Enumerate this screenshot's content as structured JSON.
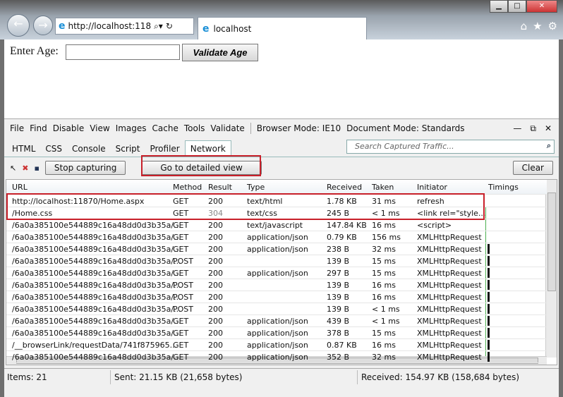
{
  "browser": {
    "address": "http://localhost:118",
    "tab_title": "localhost",
    "window_controls": [
      "minimize",
      "maximize",
      "close"
    ]
  },
  "page": {
    "label": "Enter Age:",
    "input_value": "",
    "button": "Validate Age"
  },
  "devtools": {
    "menu": [
      "File",
      "Find",
      "Disable",
      "View",
      "Images",
      "Cache",
      "Tools",
      "Validate"
    ],
    "browser_mode": "Browser Mode: IE10",
    "document_mode": "Document Mode: Standards",
    "tabs": [
      "HTML",
      "CSS",
      "Console",
      "Script",
      "Profiler",
      "Network"
    ],
    "active_tab": "Network",
    "search_placeholder": "Search Captured Traffic...",
    "stop_button": "Stop capturing",
    "detail_button": "Go to detailed view",
    "clear_button": "Clear",
    "columns": [
      "URL",
      "Method",
      "Result",
      "Type",
      "Received",
      "Taken",
      "Initiator",
      "Timings"
    ],
    "rows": [
      [
        "http://localhost:11870/Home.aspx",
        "GET",
        "200",
        "text/html",
        "1.78 KB",
        "31 ms",
        "refresh"
      ],
      [
        "/Home.css",
        "GET",
        "304",
        "text/css",
        "245 B",
        "< 1 ms",
        "<link rel=\"style..."
      ],
      [
        "/6a0a385100e544889c16a48dd0d3b35a/...",
        "GET",
        "200",
        "text/javascript",
        "147.84 KB",
        "16 ms",
        "<script>"
      ],
      [
        "/6a0a385100e544889c16a48dd0d3b35a/...",
        "GET",
        "200",
        "application/json",
        "0.79 KB",
        "156 ms",
        "XMLHttpRequest"
      ],
      [
        "/6a0a385100e544889c16a48dd0d3b35a/...",
        "GET",
        "200",
        "application/json",
        "238 B",
        "32 ms",
        "XMLHttpRequest"
      ],
      [
        "/6a0a385100e544889c16a48dd0d3b35a/...",
        "POST",
        "200",
        "",
        "139 B",
        "15 ms",
        "XMLHttpRequest"
      ],
      [
        "/6a0a385100e544889c16a48dd0d3b35a/...",
        "GET",
        "200",
        "application/json",
        "297 B",
        "15 ms",
        "XMLHttpRequest"
      ],
      [
        "/6a0a385100e544889c16a48dd0d3b35a/...",
        "POST",
        "200",
        "",
        "139 B",
        "16 ms",
        "XMLHttpRequest"
      ],
      [
        "/6a0a385100e544889c16a48dd0d3b35a/...",
        "POST",
        "200",
        "",
        "139 B",
        "16 ms",
        "XMLHttpRequest"
      ],
      [
        "/6a0a385100e544889c16a48dd0d3b35a/...",
        "POST",
        "200",
        "",
        "139 B",
        "< 1 ms",
        "XMLHttpRequest"
      ],
      [
        "/6a0a385100e544889c16a48dd0d3b35a/...",
        "GET",
        "200",
        "application/json",
        "439 B",
        "< 1 ms",
        "XMLHttpRequest"
      ],
      [
        "/6a0a385100e544889c16a48dd0d3b35a/...",
        "GET",
        "200",
        "application/json",
        "378 B",
        "15 ms",
        "XMLHttpRequest"
      ],
      [
        "/__browserLink/requestData/741f875965...",
        "GET",
        "200",
        "application/json",
        "0.87 KB",
        "16 ms",
        "XMLHttpRequest"
      ],
      [
        "/6a0a385100e544889c16a48dd0d3b35a/...",
        "GET",
        "200",
        "application/json",
        "352 B",
        "32 ms",
        "XMLHttpRequest"
      ]
    ],
    "status": {
      "items": "Items: 21",
      "sent": "Sent: 21.15 KB (21,658 bytes)",
      "received": "Received: 154.97 KB (158,684 bytes)"
    }
  }
}
